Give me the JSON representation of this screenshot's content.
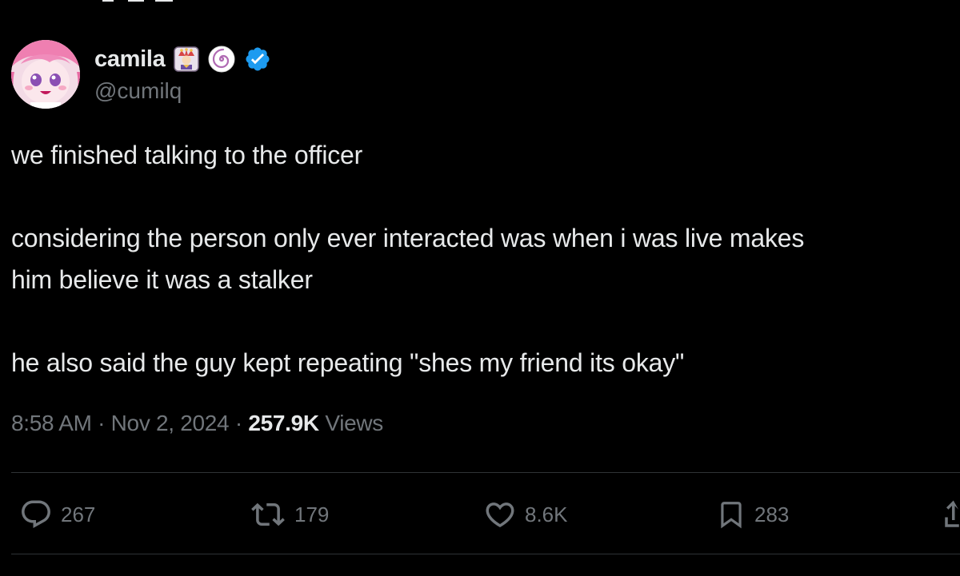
{
  "post": {
    "author": {
      "display_name": "camila",
      "handle": "@cumilq",
      "badges": [
        "jester-emoji-icon",
        "swirl-badge-icon",
        "verified-badge-icon"
      ]
    },
    "text": {
      "line1": "we finished talking to the officer",
      "line2": "considering the person only ever interacted was when i was live makes",
      "line3": "him believe it was a stalker",
      "line4": "he also said the guy kept repeating \"shes my friend its okay\""
    },
    "meta": {
      "time": "8:58 AM",
      "separator": "·",
      "date": "Nov 2, 2024",
      "views_count": "257.9K",
      "views_label": "Views"
    },
    "actions": {
      "replies": "267",
      "reposts": "179",
      "likes": "8.6K",
      "bookmarks": "283"
    }
  },
  "colors": {
    "background": "#000000",
    "primary_text": "#e7e9ea",
    "secondary_text": "#71767b",
    "divider": "#2f3336",
    "verified": "#1d9bf0"
  }
}
